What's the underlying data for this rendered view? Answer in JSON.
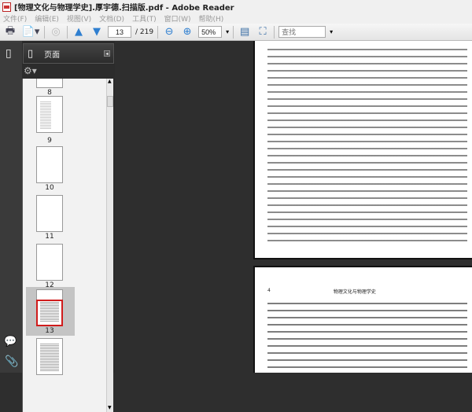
{
  "window": {
    "title": "[物理文化与物理学史].厚宇德.扫描版.pdf - Adobe Reader"
  },
  "menu": [
    "文件(F)",
    "编辑(E)",
    "视图(V)",
    "文档(D)",
    "工具(T)",
    "窗口(W)",
    "帮助(H)"
  ],
  "toolbar": {
    "page_current": "13",
    "page_total": "/ 219",
    "zoom": "50%",
    "search_placeholder": "查找"
  },
  "panel": {
    "title": "页面"
  },
  "thumbnails": [
    {
      "label": "8"
    },
    {
      "label": "9"
    },
    {
      "label": "10"
    },
    {
      "label": "11"
    },
    {
      "label": "12"
    },
    {
      "label": "13",
      "selected": true
    }
  ],
  "document": {
    "page_number": "4",
    "running_header": "物理文化与物理学史"
  },
  "colors": {
    "selection_border": "#d01c1c",
    "accent_blue": "#2f7fd0"
  }
}
